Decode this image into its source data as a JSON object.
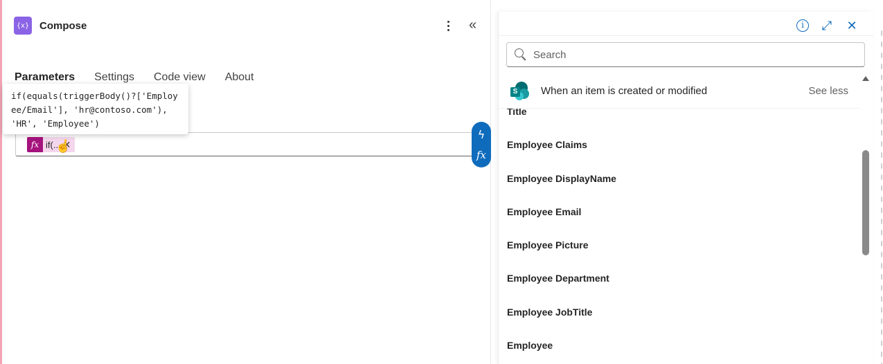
{
  "app": {
    "title": "Compose",
    "icon_glyph": "{x}",
    "accent_color": "#8a63e6"
  },
  "tabs": [
    {
      "label": "Parameters",
      "active": true
    },
    {
      "label": "Settings",
      "active": false
    },
    {
      "label": "Code view",
      "active": false
    },
    {
      "label": "About",
      "active": false
    }
  ],
  "tooltip": {
    "text": "if(equals(triggerBody()?['Employee/Email'], 'hr@contoso.com'), 'HR', 'Employee')"
  },
  "inputs": {
    "token_label": "if(...",
    "token_icon": "fx"
  },
  "side_toolbar": {
    "dynamic_icon": "lightning-icon",
    "expression_icon": "fx"
  },
  "dynamic_panel": {
    "search_placeholder": "Search",
    "group_title": "When an item is created or modified",
    "see_less": "See less",
    "items": [
      "Title",
      "Employee Claims",
      "Employee DisplayName",
      "Employee Email",
      "Employee Picture",
      "Employee Department",
      "Employee JobTitle",
      "Employee"
    ]
  },
  "colors": {
    "primary": "#0f6cbd",
    "token_icon_bg": "#a5137d",
    "token_bg": "#f4d7ec"
  }
}
